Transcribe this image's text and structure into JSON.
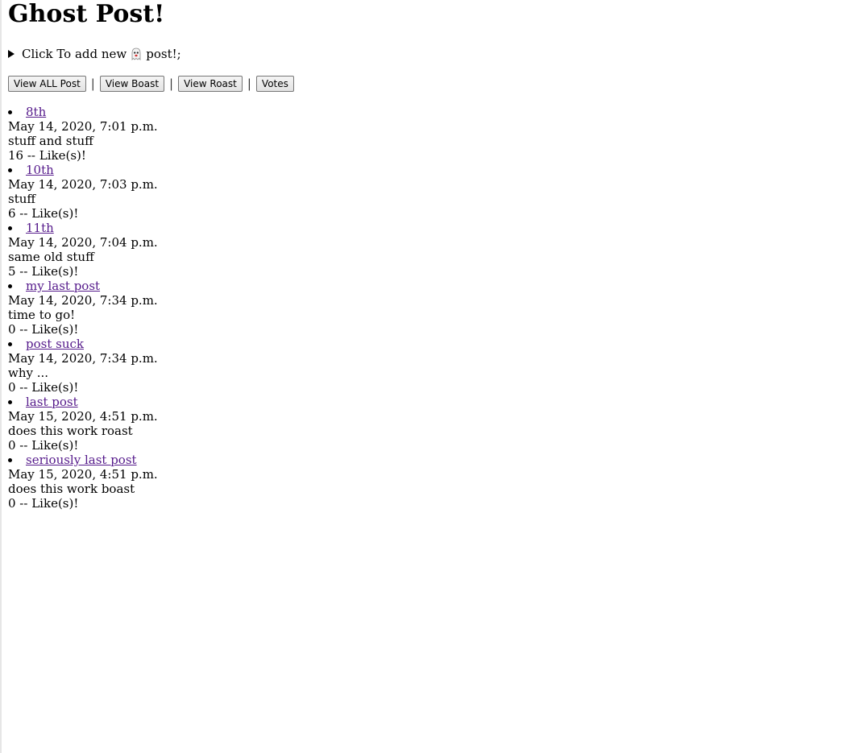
{
  "page": {
    "title": "Ghost Post!"
  },
  "summary": {
    "text_before": "Click To add new",
    "icon": "ghost-icon",
    "text_after": "post!;"
  },
  "nav": {
    "view_all": "View ALL Post",
    "view_boast": "View Boast",
    "view_roast": "View Roast",
    "votes": "Votes",
    "separator": "|"
  },
  "colors": {
    "visited_link": "#551a8b"
  },
  "posts": [
    {
      "title": "8th",
      "date": "May 14, 2020, 7:01 p.m.",
      "body": "stuff and stuff",
      "likes": "16 -- Like(s)!"
    },
    {
      "title": "10th",
      "date": "May 14, 2020, 7:03 p.m.",
      "body": "stuff",
      "likes": "6 -- Like(s)!"
    },
    {
      "title": "11th",
      "date": "May 14, 2020, 7:04 p.m.",
      "body": "same old stuff",
      "likes": "5 -- Like(s)!"
    },
    {
      "title": "my last post",
      "date": "May 14, 2020, 7:34 p.m.",
      "body": "time to go!",
      "likes": "0 -- Like(s)!"
    },
    {
      "title": "post suck",
      "date": "May 14, 2020, 7:34 p.m.",
      "body": "why ...",
      "likes": "0 -- Like(s)!"
    },
    {
      "title": "last post",
      "date": "May 15, 2020, 4:51 p.m.",
      "body": "does this work roast",
      "likes": "0 -- Like(s)!"
    },
    {
      "title": "seriously last post",
      "date": "May 15, 2020, 4:51 p.m.",
      "body": "does this work boast",
      "likes": "0 -- Like(s)!"
    }
  ]
}
